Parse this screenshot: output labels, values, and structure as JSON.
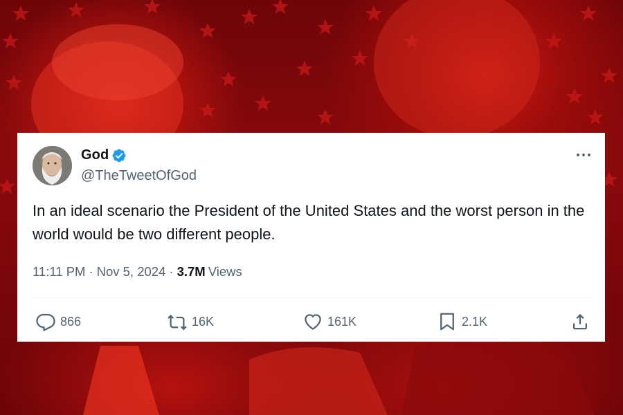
{
  "tweet": {
    "author_name": "God",
    "handle": "@TheTweetOfGod",
    "text": "In an ideal scenario the President of the United States and the worst person in the world would be two different people.",
    "time": "11:11 PM",
    "date": "Nov 5, 2024",
    "separator": "·",
    "views_count": "3.7M",
    "views_label": "Views"
  },
  "actions": {
    "replies": "866",
    "reposts": "16K",
    "likes": "161K",
    "bookmarks": "2.1K"
  },
  "icons": {
    "verified": "verified-badge-icon",
    "more": "more-icon",
    "reply": "reply-icon",
    "repost": "repost-icon",
    "like": "heart-icon",
    "bookmark": "bookmark-icon",
    "share": "share-icon"
  },
  "colors": {
    "verified_blue": "#1d9bf0",
    "text_primary": "#0f1419",
    "text_secondary": "#536471",
    "background_red": "#b0120e"
  }
}
